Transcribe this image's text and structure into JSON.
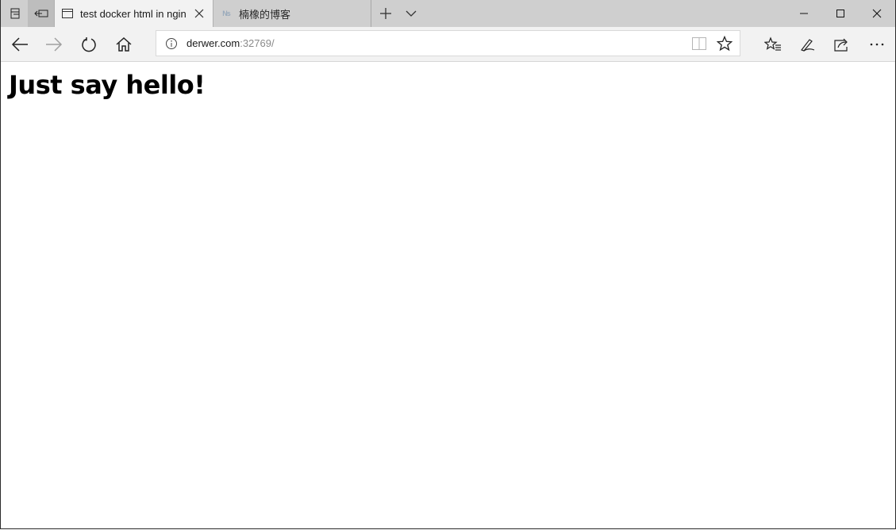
{
  "tabs": [
    {
      "title": "test docker html in ngin",
      "active": true,
      "icon": "page-icon"
    },
    {
      "title": "楠橡的博客",
      "active": false,
      "icon": "ns-favicon-icon",
      "favicon_text": "Ns"
    }
  ],
  "address_bar": {
    "host": "derwer.com",
    "port_path": ":32769/"
  },
  "page": {
    "heading": "Just say hello!"
  },
  "colors": {
    "tabstrip": "#cfcfcf",
    "toolbar": "#f2f2f2",
    "url_dim": "#8a8a8a"
  }
}
